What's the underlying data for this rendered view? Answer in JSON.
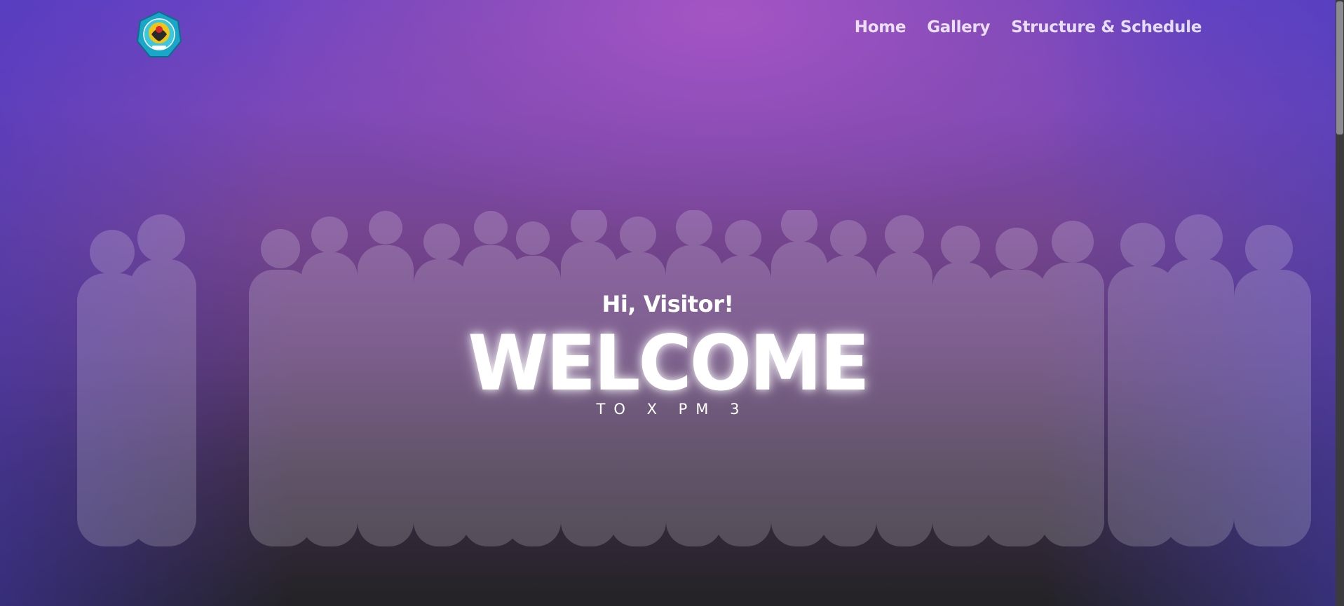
{
  "header": {
    "logo_icon": "school-emblem-icon",
    "nav": [
      {
        "label": "Home"
      },
      {
        "label": "Gallery"
      },
      {
        "label": "Structure & Schedule"
      }
    ]
  },
  "hero": {
    "greeting": "Hi, Visitor!",
    "title": "WELCOME",
    "subtitle": "TO X PM 3"
  },
  "colors": {
    "hero_top": "#9a55c0",
    "hero_edge": "#5a3fc6",
    "hero_bottom": "#232225",
    "text": "#ffffff"
  }
}
